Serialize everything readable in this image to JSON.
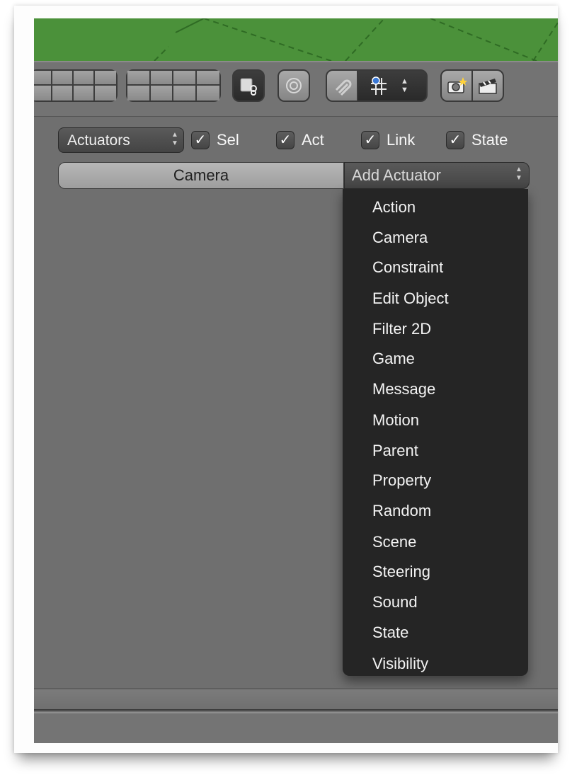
{
  "logic": {
    "type_dropdown": "Actuators",
    "checkboxes": {
      "sel": "Sel",
      "act": "Act",
      "link": "Link",
      "state": "State"
    }
  },
  "actuator": {
    "name": "Camera",
    "add_label": "Add Actuator"
  },
  "menu": {
    "items": [
      "Action",
      "Camera",
      "Constraint",
      "Edit Object",
      "Filter 2D",
      "Game",
      "Message",
      "Motion",
      "Parent",
      "Property",
      "Random",
      "Scene",
      "Steering",
      "Sound",
      "State",
      "Visibility"
    ]
  },
  "icons": {
    "toolbar": [
      "layers-grid-icon",
      "layers-grid-icon",
      "object-link-icon",
      "proportional-edit-icon",
      "snap-magnet-icon",
      "snap-grid-icon",
      "render-camera-icon",
      "render-clapper-icon"
    ],
    "check": "checkmark-icon",
    "updown": "up-down-arrows-icon"
  },
  "colors": {
    "viewport_green": "#4b913a",
    "panel_gray": "#6f6f6f",
    "menu_bg": "#252525"
  }
}
